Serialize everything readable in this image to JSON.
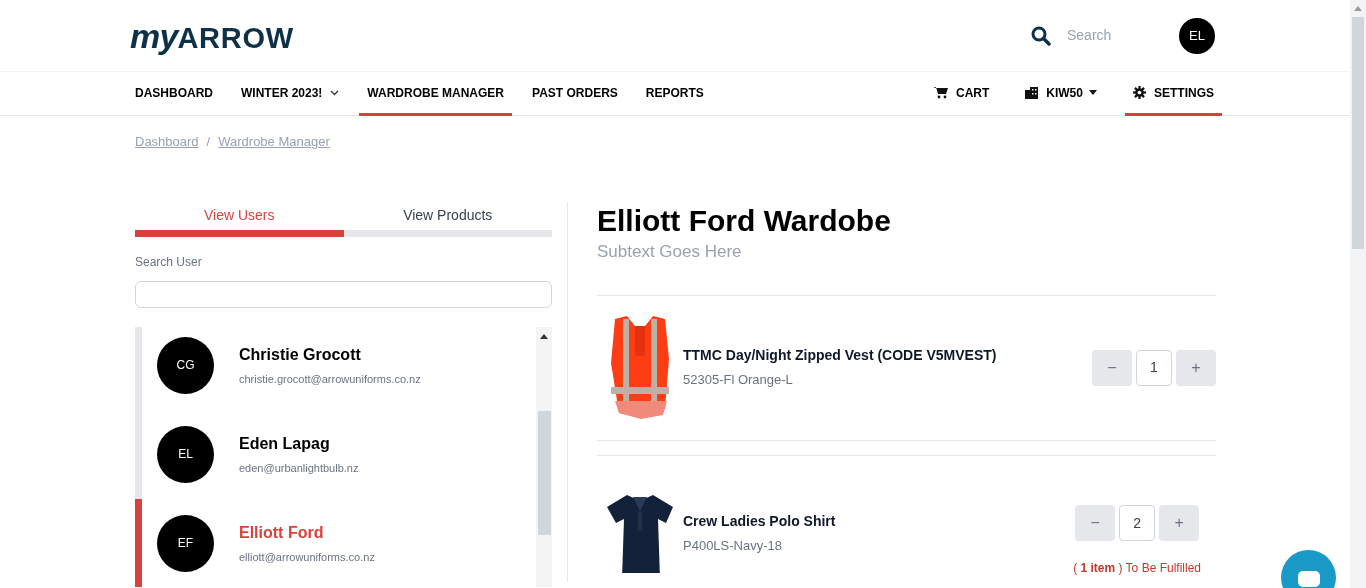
{
  "logo": {
    "script": "my",
    "word": "ARROW"
  },
  "search": {
    "placeholder": "Search"
  },
  "avatar": "EL",
  "nav_left": [
    {
      "label": "DASHBOARD",
      "selected": false,
      "dropdown": false
    },
    {
      "label": "WINTER 2023!",
      "selected": false,
      "dropdown": true
    },
    {
      "label": "WARDROBE MANAGER",
      "selected": true,
      "dropdown": false
    },
    {
      "label": "PAST ORDERS",
      "selected": false,
      "dropdown": false
    },
    {
      "label": "REPORTS",
      "selected": false,
      "dropdown": false
    }
  ],
  "nav_right": [
    {
      "kind": "cart",
      "label": "CART",
      "selected": false
    },
    {
      "kind": "store",
      "label": "KIW50",
      "selected": false
    },
    {
      "kind": "settings",
      "label": "SETTINGS",
      "selected": true
    }
  ],
  "breadcrumb": [
    "Dashboard",
    "Wardrobe Manager"
  ],
  "breadcrumb_separator": "/",
  "tabs": [
    {
      "label": "View Users",
      "selected": true
    },
    {
      "label": "View Products",
      "selected": false
    }
  ],
  "search_user": {
    "label": "Search User"
  },
  "users": [
    {
      "initials": "CG",
      "name": "Christie Grocott",
      "email": "christie.grocott@arrowuniforms.co.nz",
      "selected": false
    },
    {
      "initials": "EL",
      "name": "Eden Lapag",
      "email": "eden@urbanlightbulb.nz",
      "selected": false
    },
    {
      "initials": "EF",
      "name": "Elliott Ford",
      "email": "elliott@arrowuniforms.co.nz",
      "selected": true
    }
  ],
  "title": "Elliott Ford Wardobe",
  "subtitle": "Subtext Goes Here",
  "products": [
    {
      "kind": "vest",
      "name": "TTMC Day/Night Zipped Vest (CODE V5MVEST)",
      "code": "52305-Fl Orange-L",
      "qty": "1",
      "minus": "−",
      "plus": "+"
    },
    {
      "kind": "polo",
      "name": "Crew Ladies Polo Shirt",
      "code": "P400LS-Navy-18",
      "qty": "2",
      "minus": "−",
      "plus": "+",
      "note": "( **1 item** ) To Be Fulfilled"
    }
  ]
}
